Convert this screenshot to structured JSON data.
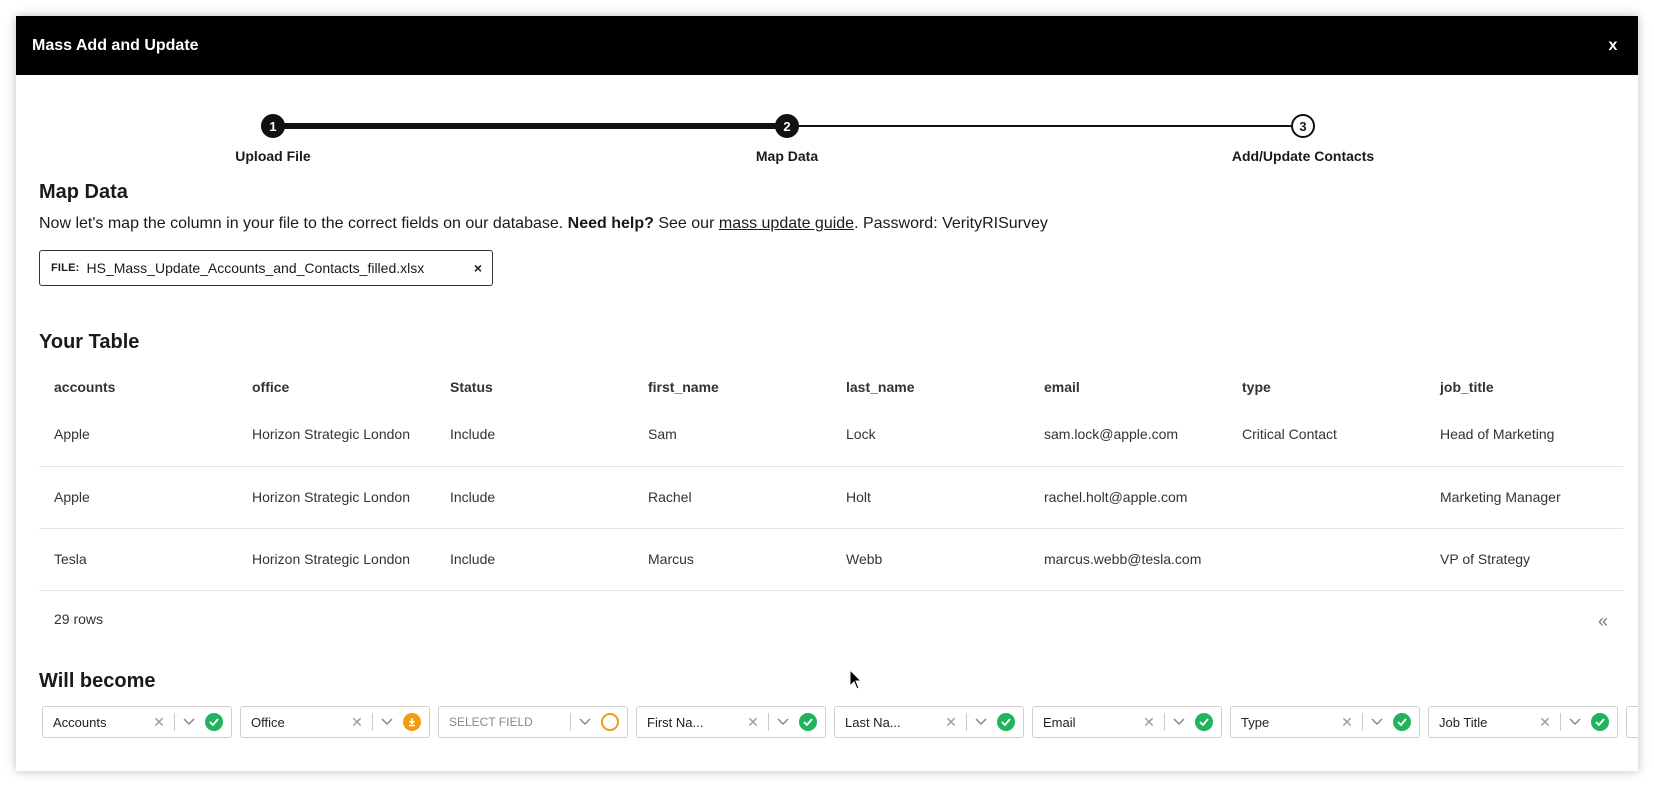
{
  "modal": {
    "title": "Mass Add and Update",
    "close": "x"
  },
  "stepper": {
    "steps": [
      {
        "number": "1",
        "label": "Upload File"
      },
      {
        "number": "2",
        "label": "Map Data"
      },
      {
        "number": "3",
        "label": "Add/Update Contacts"
      }
    ],
    "current_step": 2
  },
  "map_data": {
    "heading": "Map Data",
    "intro_start": "Now let's map the column in your file to the correct fields on our database.",
    "intro_bold": "Need help?",
    "intro_see": "See our",
    "intro_link": "mass update guide",
    "intro_end": ". Password: VerityRISurvey",
    "file": {
      "label": "FILE:",
      "name": "HS_Mass_Update_Accounts_and_Contacts_filled.xlsx",
      "remove": "×"
    }
  },
  "your_table": {
    "heading": "Your Table",
    "columns": [
      "accounts",
      "office",
      "Status",
      "first_name",
      "last_name",
      "email",
      "type",
      "job_title"
    ],
    "rows": [
      [
        "Apple",
        "Horizon Strategic London",
        "Include",
        "Sam",
        "Lock",
        "sam.lock@apple.com",
        "Critical Contact",
        "Head of Marketing"
      ],
      [
        "Apple",
        "Horizon Strategic London",
        "Include",
        "Rachel",
        "Holt",
        "rachel.holt@apple.com",
        "",
        "Marketing Manager"
      ],
      [
        "Tesla",
        "Horizon Strategic London",
        "Include",
        "Marcus",
        "Webb",
        "marcus.webb@tesla.com",
        "",
        "VP of Strategy"
      ]
    ],
    "row_count": "29 rows",
    "pager": "«"
  },
  "will_become": {
    "heading": "Will become",
    "mappings": [
      {
        "value": "Accounts",
        "status": "ok",
        "clearable": true
      },
      {
        "value": "Office",
        "status": "warn",
        "clearable": true
      },
      {
        "value": "SELECT FIELD",
        "status": "empty",
        "clearable": false
      },
      {
        "value": "First Na...",
        "status": "ok",
        "clearable": true
      },
      {
        "value": "Last Na...",
        "status": "ok",
        "clearable": true
      },
      {
        "value": "Email",
        "status": "ok",
        "clearable": true
      },
      {
        "value": "Type",
        "status": "ok",
        "clearable": true
      },
      {
        "value": "Job Title",
        "status": "ok",
        "clearable": true
      }
    ],
    "clear_glyph": "✕"
  },
  "colors": {
    "header_bg": "#000000",
    "ok": "#22b35e",
    "warn": "#f29b12"
  }
}
